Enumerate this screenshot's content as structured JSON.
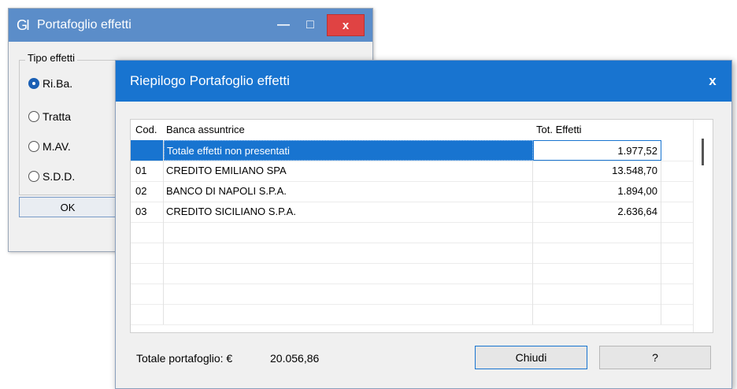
{
  "back_window": {
    "logo": "GI",
    "title": "Portafoglio effetti",
    "minimize_glyph": "—",
    "maximize_glyph": "□",
    "close_glyph": "x",
    "group_label": "Tipo effetti",
    "radios": [
      {
        "label": "Ri.Ba.",
        "checked": true
      },
      {
        "label": "Tratta",
        "checked": false
      },
      {
        "label": "M.AV.",
        "checked": false
      },
      {
        "label": "S.D.D.",
        "checked": false
      }
    ],
    "ok_label": "OK"
  },
  "dialog": {
    "title": "Riepilogo Portafoglio effetti",
    "close_glyph": "x",
    "columns": [
      "Cod.",
      "Banca assuntrice",
      "Tot. Effetti"
    ],
    "rows": [
      {
        "cod": "",
        "banca": "Totale effetti non presentati",
        "tot": "1.977,52",
        "selected": true
      },
      {
        "cod": "01",
        "banca": "CREDITO EMILIANO SPA",
        "tot": "13.548,70"
      },
      {
        "cod": "02",
        "banca": "BANCO DI NAPOLI S.P.A.",
        "tot": "1.894,00"
      },
      {
        "cod": "03",
        "banca": "CREDITO SICILIANO S.P.A.",
        "tot": "2.636,64"
      }
    ],
    "total_label": "Totale portafoglio: €",
    "total_value": "20.056,86",
    "chiudi_label": "Chiudi",
    "help_label": "?"
  }
}
